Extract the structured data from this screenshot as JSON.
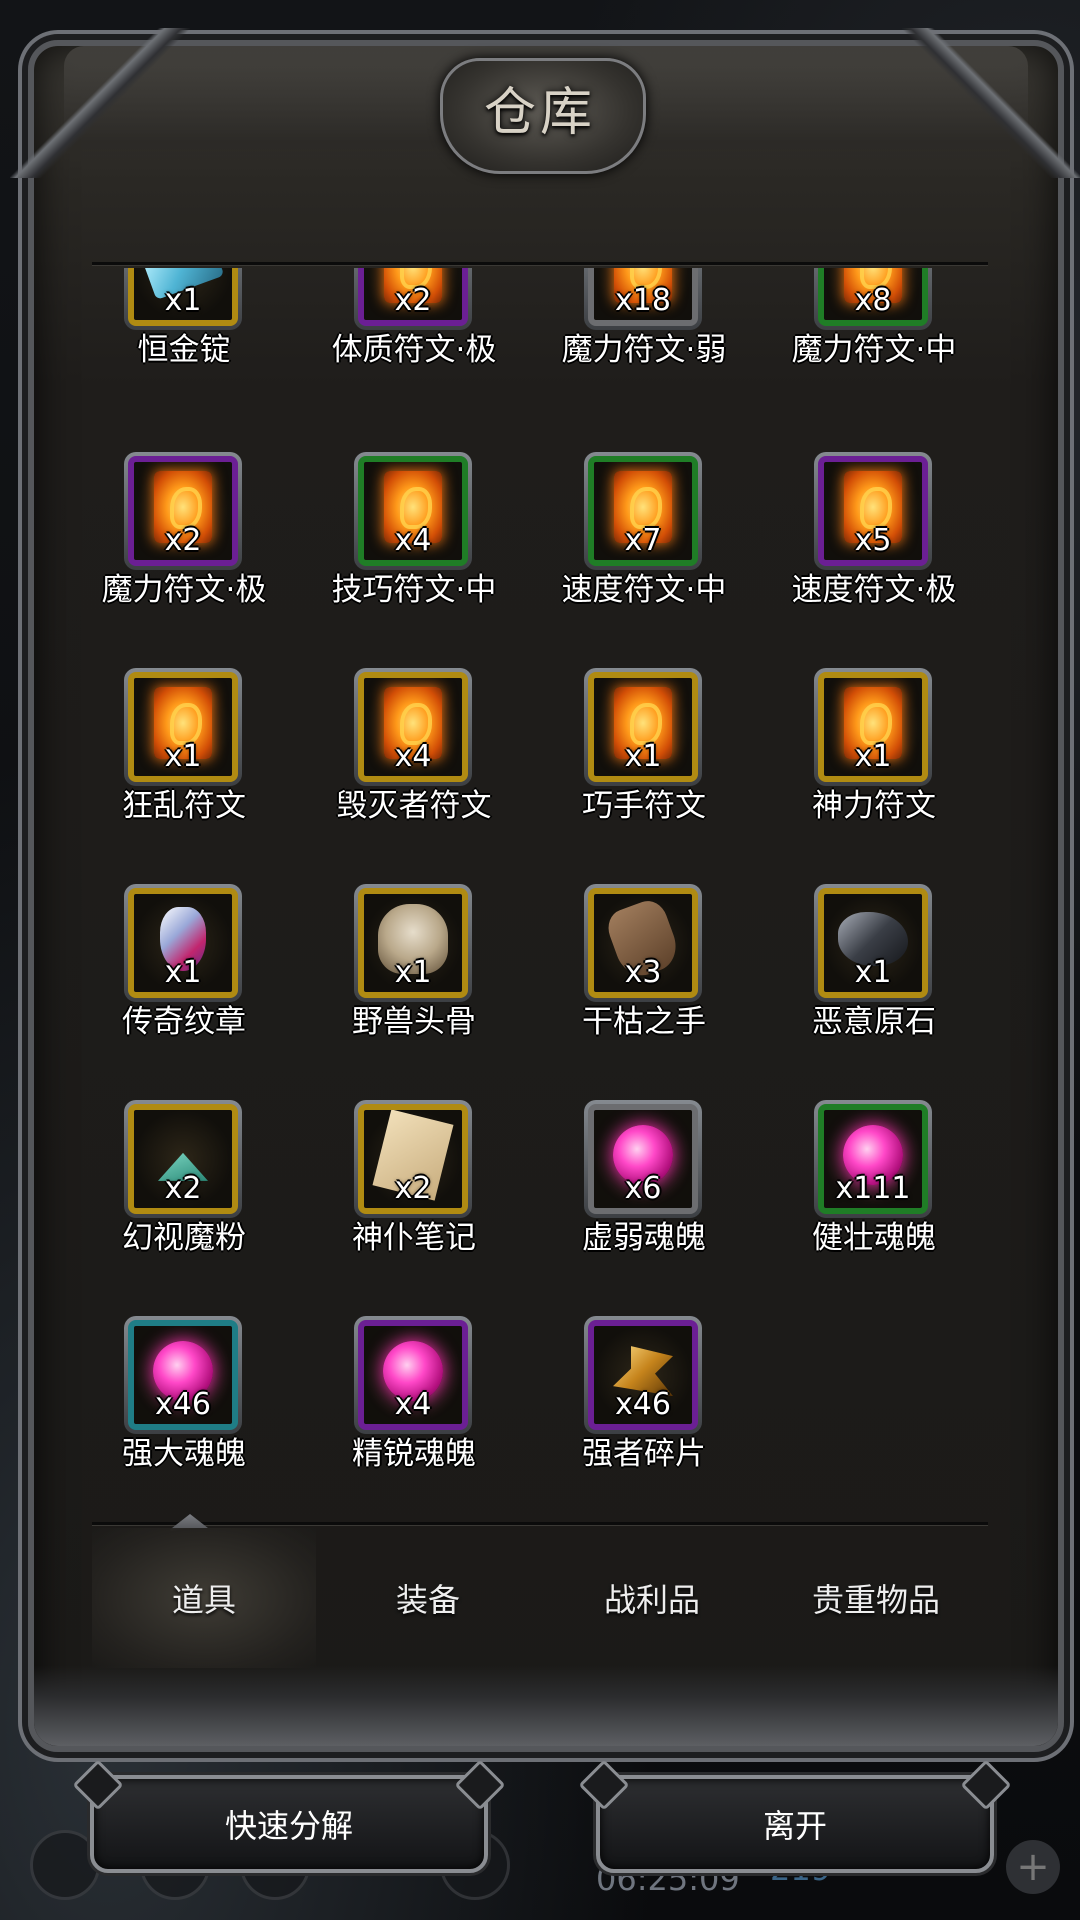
{
  "window": {
    "title": "仓库"
  },
  "items": [
    {
      "name": "恒金锭",
      "qty": "x1",
      "icon": "ingot-icon",
      "rarity": "gold"
    },
    {
      "name": "体质符文·极",
      "qty": "x2",
      "icon": "rune-icon",
      "rarity": "purple"
    },
    {
      "name": "魔力符文·弱",
      "qty": "x18",
      "icon": "rune-icon",
      "rarity": "gray"
    },
    {
      "name": "魔力符文·中",
      "qty": "x8",
      "icon": "rune-icon",
      "rarity": "green"
    },
    {
      "name": "魔力符文·极",
      "qty": "x2",
      "icon": "rune-icon",
      "rarity": "purple"
    },
    {
      "name": "技巧符文·中",
      "qty": "x4",
      "icon": "rune-icon",
      "rarity": "green"
    },
    {
      "name": "速度符文·中",
      "qty": "x7",
      "icon": "rune-icon",
      "rarity": "green"
    },
    {
      "name": "速度符文·极",
      "qty": "x5",
      "icon": "rune-icon",
      "rarity": "purple"
    },
    {
      "name": "狂乱符文",
      "qty": "x1",
      "icon": "rune-icon",
      "rarity": "gold"
    },
    {
      "name": "毁灭者符文",
      "qty": "x4",
      "icon": "rune-icon",
      "rarity": "gold"
    },
    {
      "name": "巧手符文",
      "qty": "x1",
      "icon": "rune-icon",
      "rarity": "gold"
    },
    {
      "name": "神力符文",
      "qty": "x1",
      "icon": "rune-icon",
      "rarity": "gold"
    },
    {
      "name": "传奇纹章",
      "qty": "x1",
      "icon": "emblem-icon",
      "rarity": "gold"
    },
    {
      "name": "野兽头骨",
      "qty": "x1",
      "icon": "skull-icon",
      "rarity": "gold"
    },
    {
      "name": "干枯之手",
      "qty": "x3",
      "icon": "hand-icon",
      "rarity": "gold"
    },
    {
      "name": "恶意原石",
      "qty": "x1",
      "icon": "ore-icon",
      "rarity": "gold"
    },
    {
      "name": "幻视魔粉",
      "qty": "x2",
      "icon": "powder-icon",
      "rarity": "gold"
    },
    {
      "name": "神仆笔记",
      "qty": "x2",
      "icon": "paper-icon",
      "rarity": "gold"
    },
    {
      "name": "虚弱魂魄",
      "qty": "x6",
      "icon": "soul-icon",
      "rarity": "gray"
    },
    {
      "name": "健壮魂魄",
      "qty": "x111",
      "icon": "soul-icon",
      "rarity": "green"
    },
    {
      "name": "强大魂魄",
      "qty": "x46",
      "icon": "soul-icon",
      "rarity": "teal"
    },
    {
      "name": "精锐魂魄",
      "qty": "x4",
      "icon": "soul-icon",
      "rarity": "purple"
    },
    {
      "name": "强者碎片",
      "qty": "x46",
      "icon": "shard-icon",
      "rarity": "purple"
    }
  ],
  "tabs": [
    {
      "label": "道具",
      "active": true
    },
    {
      "label": "装备",
      "active": false
    },
    {
      "label": "战利品",
      "active": false
    },
    {
      "label": "贵重物品",
      "active": false
    }
  ],
  "buttons": {
    "decompose": "快速分解",
    "leave": "离开"
  },
  "hud": {
    "clock": "06:25:09",
    "score": "219"
  }
}
